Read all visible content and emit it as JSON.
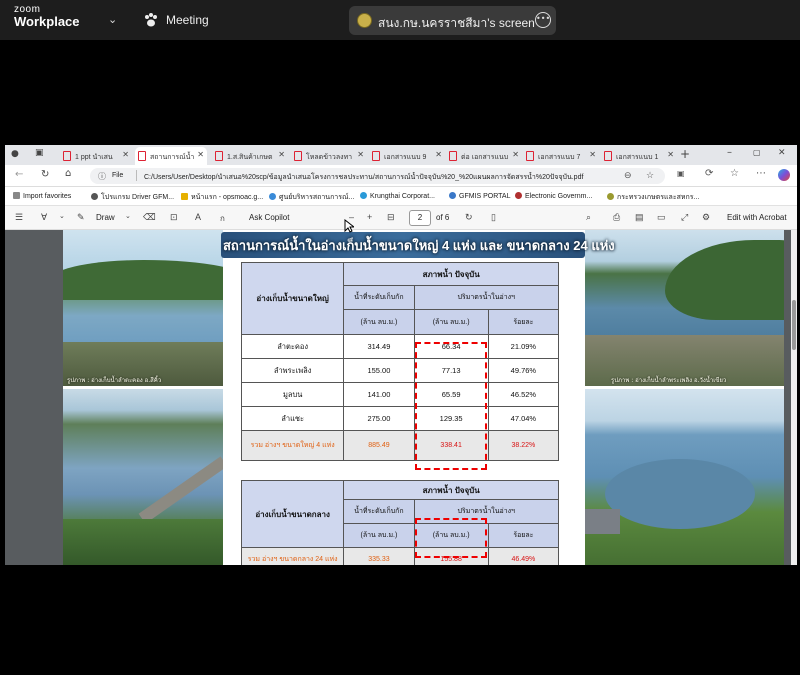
{
  "zoom": {
    "brand_top": "zoom",
    "brand_bottom": "Workplace",
    "meeting_label": "Meeting",
    "share_label": "สนง.กษ.นครราชสีมา's screen"
  },
  "browser": {
    "tabs": [
      {
        "label": "1 ppt นำเสน"
      },
      {
        "label": "สถานการณ์น้ำ"
      },
      {
        "label": "1.ส.สินค้าเกษต"
      },
      {
        "label": "โหลดข้าวลงทา"
      },
      {
        "label": "เอกสารแนบ 9"
      },
      {
        "label": "ต่อ เอกสารแนบ"
      },
      {
        "label": "เอกสารแนบ 7"
      },
      {
        "label": "เอกสารแนบ 1"
      }
    ],
    "url_scheme": "File",
    "url": "C:/Users/User/Desktop/นำเสนอ%20scp/ข้อมูลนำเสนอโครงการชลประทาน/สถานการณ์น้ำปัจจุบัน%20_%20แผนผลการจัดสรรน้ำ%20ปัจจุบัน.pdf",
    "bookmarks": [
      {
        "label": "Import favorites"
      },
      {
        "label": "โปรแกรม Driver GFM..."
      },
      {
        "label": "หน้าแรก - opsmoac.g..."
      },
      {
        "label": "ศูนย์บริหารสถานการณ์..."
      },
      {
        "label": "Krungthai Corporat..."
      },
      {
        "label": "GFMIS PORTAL"
      },
      {
        "label": "Electronic Governm..."
      },
      {
        "label": "กระทรวงเกษตรและสหกร..."
      }
    ]
  },
  "pdf_toolbar": {
    "draw_label": "Draw",
    "copilot_label": "Ask Copilot",
    "page_current": "2",
    "page_total": "of 6",
    "edit_label": "Edit with Acrobat"
  },
  "slide": {
    "title": "สถานการณ์น้ำในอ่างเก็บน้ำขนาดใหญ่ 4 แห่ง และ ขนาดกลาง 24 แห่ง",
    "caption_left": "รูปภาพ : อ่างเก็บน้ำลำตะคอง อ.สีคิ้ว",
    "caption_right": "รูปภาพ : อ่างเก็บน้ำลำพระเพลิง อ.วังน้ำเขียว",
    "large": {
      "header_name": "อ่างเก็บน้ำขนาดใหญ่",
      "header_status": "สภาพน้ำ ปัจจุบัน",
      "header_capacity": "น้ำที่ระดับเก็บกัก",
      "header_volume": "ปริมาตรน้ำในอ่างฯ",
      "unit_capacity": "(ล้าน ลบ.ม.)",
      "unit_volume": "(ล้าน ลบ.ม.)",
      "unit_percent": "ร้อยละ",
      "rows": [
        {
          "name": "ลำตะคอง",
          "capacity": "314.49",
          "volume": "66.34",
          "percent": "21.09%"
        },
        {
          "name": "ลำพระเพลิง",
          "capacity": "155.00",
          "volume": "77.13",
          "percent": "49.76%"
        },
        {
          "name": "มูลบน",
          "capacity": "141.00",
          "volume": "65.59",
          "percent": "46.52%"
        },
        {
          "name": "ลำแชะ",
          "capacity": "275.00",
          "volume": "129.35",
          "percent": "47.04%"
        }
      ],
      "total": {
        "name": "รวม อ่างฯ ขนาดใหญ่ 4 แห่ง",
        "capacity": "885.49",
        "volume": "338.41",
        "percent": "38.22%"
      }
    },
    "medium": {
      "header_name": "อ่างเก็บน้ำขนาดกลาง",
      "header_status": "สภาพน้ำ ปัจจุบัน",
      "header_capacity": "น้ำที่ระดับเก็บกัก",
      "header_volume": "ปริมาตรน้ำในอ่างฯ",
      "unit_capacity": "(ล้าน ลบ.ม.)",
      "unit_volume": "(ล้าน ลบ.ม.)",
      "unit_percent": "ร้อยละ",
      "total": {
        "name": "รวม อ่างฯ ขนาดกลาง 24 แห่ง",
        "capacity": "335.33",
        "volume": "155.88",
        "percent": "46.49%"
      }
    }
  }
}
